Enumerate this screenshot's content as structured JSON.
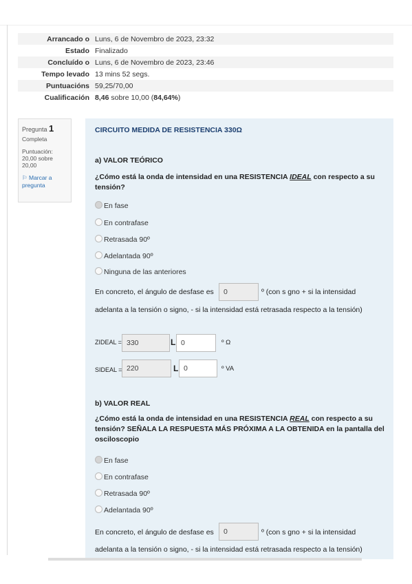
{
  "summary": [
    {
      "label": "Arrancado o",
      "value": "Luns, 6 de Novembro de 2023, 23:32"
    },
    {
      "label": "Estado",
      "value": "Finalizado"
    },
    {
      "label": "Concluído o",
      "value": "Luns, 6 de Novembro de 2023, 23:46"
    },
    {
      "label": "Tempo levado",
      "value": "13 mins 52 segs."
    },
    {
      "label": "Puntuacións",
      "value": "59,25/70,00"
    },
    {
      "label": "Cualificación",
      "value_bold1": "8,46",
      "value_mid": " sobre 10,00 (",
      "value_bold2": "84,64%",
      "value_end": ")"
    }
  ],
  "info": {
    "pregunta": "Pregunta",
    "number": "1",
    "status": "Completa",
    "puntuacion": "Puntuación: 20,00 sobre 20,00",
    "flag_icon": "flag-icon",
    "flag_label": "Marcar a pregunta"
  },
  "question": {
    "title": "CIRCUITO MEDIDA DE RESISTENCIA 330Ω",
    "sectionA": "a) VALOR TEÓRICO",
    "promptA_1": "¿Cómo está la onda de intensidad en una RESISTENCIA ",
    "promptA_em": "IDEAL",
    "promptA_2": " con respecto a su tensión?",
    "optionsA": [
      "En fase",
      "En contrafase",
      "Retrasada 90º",
      "Adelantada 90º",
      "Ninguna de las anteriores"
    ],
    "desfase_before": "En concreto, el ángulo de desfase es",
    "desfase_valueA": "0",
    "desfase_after": "º (con s gno + si la intensidad",
    "desfase_line2": "adelanta a la tensión o signo, - si la intensidad está retrasada respecto a la tensión)",
    "z_label": "ZIDEAL =",
    "z_value": "330",
    "z_angle": "0",
    "z_unit": "º Ω",
    "s_label": "SIDEAL =",
    "s_value": "220",
    "s_angle": "0",
    "s_unit": "º VA",
    "angle_symbol": "L",
    "sectionB": "b) VALOR REAL",
    "promptB_1": "¿Cómo está la onda de intensidad en una RESISTENCIA ",
    "promptB_em": "REAL",
    "promptB_2": " con respecto a su tensión? SEÑALA LA RESPUESTA MÁS PRÓXIMA A LA OBTENIDA en la pantalla del osciloscopio",
    "optionsB": [
      "En fase",
      "En contrafase",
      "Retrasada 90º",
      "Adelantada 90º"
    ],
    "desfase_valueB": "0"
  }
}
